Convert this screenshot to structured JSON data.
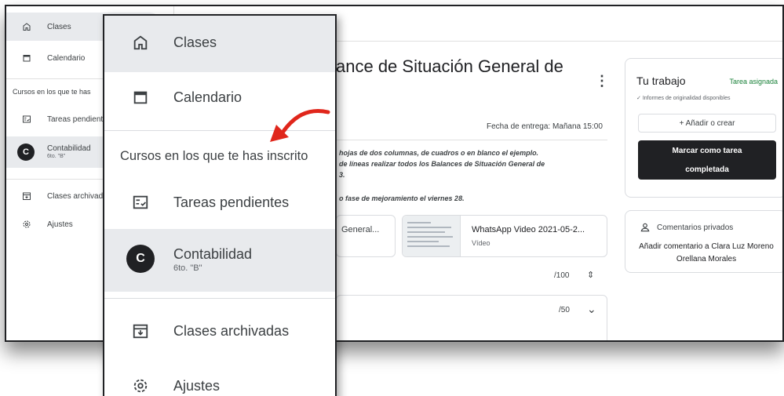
{
  "assignment": {
    "title_partial": "ance de Situación General de",
    "due": "Fecha de entrega: Mañana 15:00",
    "instructions": [
      "hojas de dos columnas, de cuadros o en blanco el ejemplo.",
      "de líneas realizar todos los Balances de Situación General de",
      "3.",
      "o fase de mejoramiento el viernes 28."
    ],
    "attachments": [
      {
        "title": "General..."
      },
      {
        "title": "WhatsApp Video 2021-05-2...",
        "type": "Vídeo"
      }
    ],
    "points_1": "/100",
    "points_2": "/50"
  },
  "work_card": {
    "title": "Tu trabajo",
    "status": "Tarea asignada",
    "originality": "Informes de originalidad disponibles",
    "add_label": "+ Añadir o crear",
    "done_line1": "Marcar como tarea",
    "done_line2": "completada"
  },
  "comment_card": {
    "title": "Comentarios privados",
    "link": "Añadir comentario a Clara Luz Moreno Orellana Morales"
  },
  "small_sidebar": {
    "classes": "Clases",
    "calendar": "Calendario",
    "heading": "Cursos en los que te has",
    "pending": "Tareas pendient",
    "course_name": "Contabilidad",
    "course_sub": "6to. \"B\"",
    "avatar": "C",
    "archived": "Clases archivad",
    "settings": "Ajustes"
  },
  "zoom_sidebar": {
    "classes": "Clases",
    "calendar": "Calendario",
    "heading": "Cursos en los que te has inscrito",
    "pending": "Tareas pendientes",
    "course_name": "Contabilidad",
    "course_sub": "6to. \"B\"",
    "avatar": "C",
    "archived": "Clases archivadas",
    "settings": "Ajustes"
  },
  "colors": {
    "accent_dark": "#202124",
    "status_green": "#188038",
    "arrow_red": "#e0261b"
  }
}
